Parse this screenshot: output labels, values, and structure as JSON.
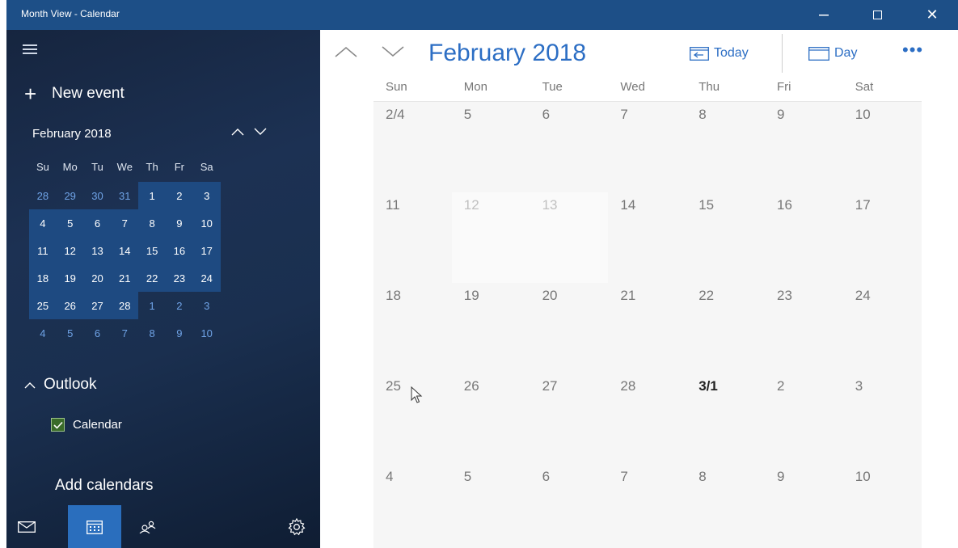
{
  "window": {
    "title": "Month View - Calendar",
    "minimize": "—",
    "maximize": "☐",
    "close": "✕"
  },
  "left": {
    "new_event": "New event",
    "plus": "+",
    "mini_month": "February 2018",
    "dow": [
      "Su",
      "Mo",
      "Tu",
      "We",
      "Th",
      "Fr",
      "Sa"
    ],
    "weeks": [
      [
        "28",
        "29",
        "30",
        "31",
        "1",
        "2",
        "3"
      ],
      [
        "4",
        "5",
        "6",
        "7",
        "8",
        "9",
        "10"
      ],
      [
        "11",
        "12",
        "13",
        "14",
        "15",
        "16",
        "17"
      ],
      [
        "18",
        "19",
        "20",
        "21",
        "22",
        "23",
        "24"
      ],
      [
        "25",
        "26",
        "27",
        "28",
        "1",
        "2",
        "3"
      ],
      [
        "4",
        "5",
        "6",
        "7",
        "8",
        "9",
        "10"
      ]
    ],
    "outlook": "Outlook",
    "calendar_item": "Calendar",
    "add_calendars": "Add calendars"
  },
  "right": {
    "month_title": "February 2018",
    "today": "Today",
    "day": "Day",
    "more": "•••",
    "dow": [
      "Sun",
      "Mon",
      "Tue",
      "Wed",
      "Thu",
      "Fri",
      "Sat"
    ],
    "weeks": [
      [
        "2/4",
        "5",
        "6",
        "7",
        "8",
        "9",
        "10"
      ],
      [
        "11",
        "12",
        "13",
        "14",
        "15",
        "16",
        "17"
      ],
      [
        "18",
        "19",
        "20",
        "21",
        "22",
        "23",
        "24"
      ],
      [
        "25",
        "26",
        "27",
        "28",
        "3/1",
        "2",
        "3"
      ],
      [
        "4",
        "5",
        "6",
        "7",
        "8",
        "9",
        "10"
      ]
    ]
  },
  "colors": {
    "titlebar": "#1d4f87",
    "accent": "#2c6ec4",
    "selected_tab": "#2a6ebd"
  }
}
